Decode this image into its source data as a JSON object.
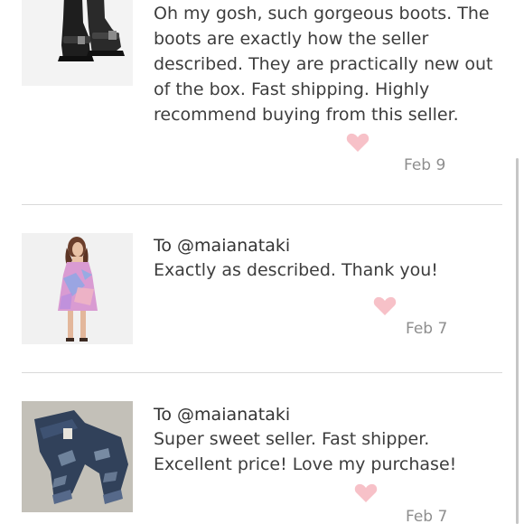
{
  "reviews": [
    {
      "to": "",
      "lines": [
        "Oh my gosh, such gorgeous boots. The",
        "boots are exactly how the seller",
        "described. They are practically new out",
        "of the box. Fast shipping. Highly",
        "recommend buying from this seller."
      ],
      "date": "Feb 9",
      "thumbnail_icon": "boots-photo"
    },
    {
      "to": "To @maianataki",
      "lines": [
        "Exactly as described. Thank you!"
      ],
      "date": "Feb 7",
      "thumbnail_icon": "dress-photo"
    },
    {
      "to": "To @maianataki",
      "lines": [
        "Super sweet seller. Fast shipper.",
        "Excellent price! Love my purchase!"
      ],
      "date": "Feb 7",
      "thumbnail_icon": "jeans-photo"
    }
  ],
  "colors": {
    "heart": "#f7c1c8",
    "divider": "#d9d9d9",
    "date_text": "#8e8e8e",
    "body_text": "#3d3d3d"
  }
}
